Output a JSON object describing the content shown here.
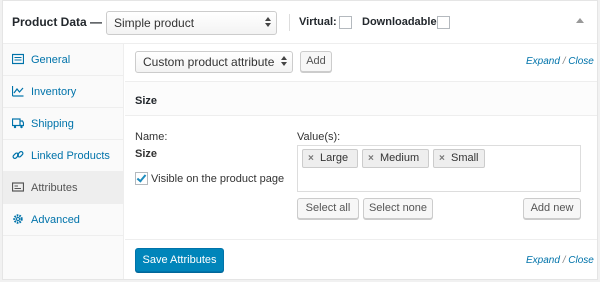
{
  "header": {
    "title": "Product Data —",
    "product_type": "Simple product",
    "virtual_label": "Virtual:",
    "downloadable_label": "Downloadable:",
    "virtual_checked": false,
    "downloadable_checked": false
  },
  "sidebar": {
    "items": [
      {
        "label": "General",
        "icon": "general-icon"
      },
      {
        "label": "Inventory",
        "icon": "inventory-icon"
      },
      {
        "label": "Shipping",
        "icon": "shipping-icon"
      },
      {
        "label": "Linked Products",
        "icon": "link-icon"
      },
      {
        "label": "Attributes",
        "icon": "attributes-icon",
        "active": true
      },
      {
        "label": "Advanced",
        "icon": "gear-icon"
      }
    ]
  },
  "toolbar": {
    "attribute_select": "Custom product attribute",
    "add_label": "Add",
    "expand": "Expand",
    "slash": " / ",
    "close": "Close"
  },
  "attribute": {
    "title": "Size",
    "name_label": "Name:",
    "name_value": "Size",
    "visible_label": "Visible on the product page",
    "visible_checked": true,
    "values_label": "Value(s):",
    "values": [
      "Large",
      "Medium",
      "Small"
    ],
    "select_all": "Select all",
    "select_none": "Select none",
    "add_new": "Add new"
  },
  "footer": {
    "save_label": "Save Attributes",
    "expand": "Expand",
    "slash": " / ",
    "close": "Close"
  },
  "colors": {
    "link": "#0073aa",
    "primary_button": "#0085ba"
  }
}
